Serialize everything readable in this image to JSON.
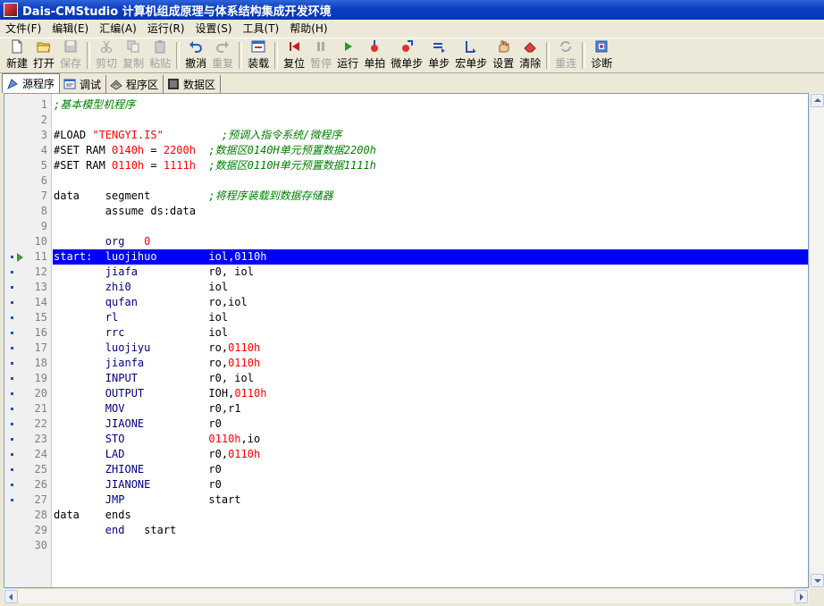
{
  "window": {
    "title": "Dais-CMStudio 计算机组成原理与体系结构集成开发环境"
  },
  "menu": [
    {
      "label": "文件(F)"
    },
    {
      "label": "编辑(E)"
    },
    {
      "label": "汇编(A)"
    },
    {
      "label": "运行(R)"
    },
    {
      "label": "设置(S)"
    },
    {
      "label": "工具(T)"
    },
    {
      "label": "帮助(H)"
    }
  ],
  "toolbar": {
    "new": "新建",
    "open": "打开",
    "save": "保存",
    "cut": "剪切",
    "copy": "复制",
    "paste": "粘贴",
    "undo": "撤消",
    "redo": "重复",
    "load": "装载",
    "reset": "复位",
    "pause": "暂停",
    "run": "运行",
    "single_beat": "单拍",
    "micro_step": "微单步",
    "single_step": "单步",
    "macro_step": "宏单步",
    "settings": "设置",
    "clear": "清除",
    "retry": "重连",
    "diagnose": "诊断"
  },
  "tabs": [
    {
      "label": "源程序"
    },
    {
      "label": "调试"
    },
    {
      "label": "程序区"
    },
    {
      "label": "数据区"
    }
  ],
  "editor": {
    "current_line": 11,
    "lines": [
      {
        "n": "1",
        "tokens": [
          {
            "c": "cm",
            "t": ";基本模型机程序"
          }
        ]
      },
      {
        "n": "2",
        "tokens": []
      },
      {
        "n": "3",
        "tokens": [
          {
            "c": "plain",
            "t": "#LOAD "
          },
          {
            "c": "str",
            "t": "\"TENGYI.IS\""
          },
          {
            "c": "plain",
            "t": "         "
          },
          {
            "c": "cm",
            "t": ";预调入指令系统/微程序"
          }
        ]
      },
      {
        "n": "4",
        "tokens": [
          {
            "c": "plain",
            "t": "#SET RAM "
          },
          {
            "c": "num",
            "t": "0140h"
          },
          {
            "c": "plain",
            "t": " = "
          },
          {
            "c": "num",
            "t": "2200h"
          },
          {
            "c": "plain",
            "t": "  "
          },
          {
            "c": "cm",
            "t": ";数据区0140H单元预置数据2200h"
          }
        ]
      },
      {
        "n": "5",
        "tokens": [
          {
            "c": "plain",
            "t": "#SET RAM "
          },
          {
            "c": "num",
            "t": "0110h"
          },
          {
            "c": "plain",
            "t": " = "
          },
          {
            "c": "num",
            "t": "1111h"
          },
          {
            "c": "plain",
            "t": "  "
          },
          {
            "c": "cm",
            "t": ";数据区0110H单元预置数据1111h"
          }
        ]
      },
      {
        "n": "6",
        "tokens": []
      },
      {
        "n": "7",
        "tokens": [
          {
            "c": "plain",
            "t": "data    segment         "
          },
          {
            "c": "cm",
            "t": ";将程序装载到数据存储器"
          }
        ]
      },
      {
        "n": "8",
        "tokens": [
          {
            "c": "plain",
            "t": "        assume ds:data"
          }
        ]
      },
      {
        "n": "9",
        "tokens": []
      },
      {
        "n": "10",
        "tokens": [
          {
            "c": "plain",
            "t": "        "
          },
          {
            "c": "kw",
            "t": "org"
          },
          {
            "c": "plain",
            "t": "   "
          },
          {
            "c": "num",
            "t": "0"
          }
        ]
      },
      {
        "n": "11",
        "mark": "arrow",
        "tokens": [
          {
            "c": "plain",
            "t": "start:  luojihuo        iol,0110h"
          }
        ]
      },
      {
        "n": "12",
        "mark": "dot",
        "tokens": [
          {
            "c": "plain",
            "t": "        "
          },
          {
            "c": "kw",
            "t": "jiafa"
          },
          {
            "c": "plain",
            "t": "           r0, iol"
          }
        ]
      },
      {
        "n": "13",
        "mark": "dot",
        "tokens": [
          {
            "c": "plain",
            "t": "        "
          },
          {
            "c": "kw",
            "t": "zhi0"
          },
          {
            "c": "plain",
            "t": "            iol"
          }
        ]
      },
      {
        "n": "14",
        "mark": "dot",
        "tokens": [
          {
            "c": "plain",
            "t": "        "
          },
          {
            "c": "kw",
            "t": "qufan"
          },
          {
            "c": "plain",
            "t": "           ro,iol"
          }
        ]
      },
      {
        "n": "15",
        "mark": "dot",
        "tokens": [
          {
            "c": "plain",
            "t": "        "
          },
          {
            "c": "kw",
            "t": "rl"
          },
          {
            "c": "plain",
            "t": "              iol"
          }
        ]
      },
      {
        "n": "16",
        "mark": "dot",
        "tokens": [
          {
            "c": "plain",
            "t": "        "
          },
          {
            "c": "kw",
            "t": "rrc"
          },
          {
            "c": "plain",
            "t": "             iol"
          }
        ]
      },
      {
        "n": "17",
        "mark": "dot",
        "tokens": [
          {
            "c": "plain",
            "t": "        "
          },
          {
            "c": "kw",
            "t": "luojiyu"
          },
          {
            "c": "plain",
            "t": "         ro,"
          },
          {
            "c": "num",
            "t": "0110h"
          }
        ]
      },
      {
        "n": "18",
        "mark": "dot",
        "tokens": [
          {
            "c": "plain",
            "t": "        "
          },
          {
            "c": "kw",
            "t": "jianfa"
          },
          {
            "c": "plain",
            "t": "          ro,"
          },
          {
            "c": "num",
            "t": "0110h"
          }
        ]
      },
      {
        "n": "19",
        "mark": "dot",
        "tokens": [
          {
            "c": "plain",
            "t": "        "
          },
          {
            "c": "kw",
            "t": "INPUT"
          },
          {
            "c": "plain",
            "t": "           r0, iol"
          }
        ]
      },
      {
        "n": "20",
        "mark": "dot",
        "tokens": [
          {
            "c": "plain",
            "t": "        "
          },
          {
            "c": "kw",
            "t": "OUTPUT"
          },
          {
            "c": "plain",
            "t": "          IOH,"
          },
          {
            "c": "num",
            "t": "0110h"
          }
        ]
      },
      {
        "n": "21",
        "mark": "dot",
        "tokens": [
          {
            "c": "plain",
            "t": "        "
          },
          {
            "c": "kw",
            "t": "MOV"
          },
          {
            "c": "plain",
            "t": "             r0,r1"
          }
        ]
      },
      {
        "n": "22",
        "mark": "dot",
        "tokens": [
          {
            "c": "plain",
            "t": "        "
          },
          {
            "c": "kw",
            "t": "JIAONE"
          },
          {
            "c": "plain",
            "t": "          r0"
          }
        ]
      },
      {
        "n": "23",
        "mark": "dot",
        "tokens": [
          {
            "c": "plain",
            "t": "        "
          },
          {
            "c": "kw",
            "t": "STO"
          },
          {
            "c": "plain",
            "t": "             "
          },
          {
            "c": "num",
            "t": "0110h"
          },
          {
            "c": "plain",
            "t": ",io"
          }
        ]
      },
      {
        "n": "24",
        "mark": "dot",
        "tokens": [
          {
            "c": "plain",
            "t": "        "
          },
          {
            "c": "kw",
            "t": "LAD"
          },
          {
            "c": "plain",
            "t": "             r0,"
          },
          {
            "c": "num",
            "t": "0110h"
          }
        ]
      },
      {
        "n": "25",
        "mark": "dot",
        "tokens": [
          {
            "c": "plain",
            "t": "        "
          },
          {
            "c": "kw",
            "t": "ZHIONE"
          },
          {
            "c": "plain",
            "t": "          r0"
          }
        ]
      },
      {
        "n": "26",
        "mark": "dot",
        "tokens": [
          {
            "c": "plain",
            "t": "        "
          },
          {
            "c": "kw",
            "t": "JIANONE"
          },
          {
            "c": "plain",
            "t": "         r0"
          }
        ]
      },
      {
        "n": "27",
        "mark": "dot",
        "tokens": [
          {
            "c": "plain",
            "t": "        "
          },
          {
            "c": "kw",
            "t": "JMP"
          },
          {
            "c": "plain",
            "t": "             start"
          }
        ]
      },
      {
        "n": "28",
        "tokens": [
          {
            "c": "plain",
            "t": "data    ends"
          }
        ]
      },
      {
        "n": "29",
        "tokens": [
          {
            "c": "plain",
            "t": "        "
          },
          {
            "c": "kw",
            "t": "end"
          },
          {
            "c": "plain",
            "t": "   start"
          }
        ]
      },
      {
        "n": "30",
        "tokens": []
      }
    ]
  },
  "colors": {
    "titlebar": "#0a3fc2",
    "selection": "#0000ff",
    "comment": "#007f00",
    "keyword": "#00007f",
    "number": "#ff0000"
  }
}
